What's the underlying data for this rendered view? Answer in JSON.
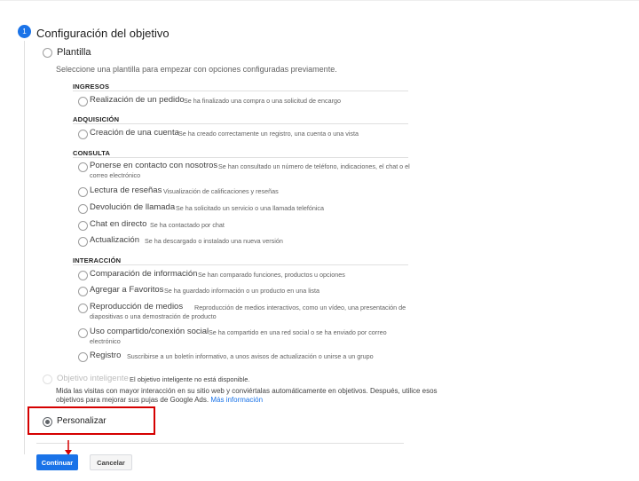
{
  "step": {
    "number": "1",
    "title": "Configuración del objetivo"
  },
  "template": {
    "label": "Plantilla",
    "description": "Seleccione una plantilla para empezar con opciones configuradas previamente.",
    "categories": [
      {
        "name": "INGRESOS",
        "options": [
          {
            "name": "Realización de un pedido",
            "desc": "Se ha finalizado una compra o una solicitud de encargo"
          }
        ]
      },
      {
        "name": "ADQUISICIÓN",
        "options": [
          {
            "name": "Creación de una cuenta",
            "desc": "Se ha creado correctamente un registro, una cuenta o una vista"
          }
        ]
      },
      {
        "name": "CONSULTA",
        "options": [
          {
            "name": "Ponerse en contacto con nosotros",
            "desc": "Se han consultado un número de teléfono, indicaciones, el chat o el correo electrónico"
          },
          {
            "name": "Lectura de reseñas",
            "desc": "Visualización de calificaciones y reseñas"
          },
          {
            "name": "Devolución de llamada",
            "desc": "Se ha solicitado un servicio o una llamada telefónica"
          },
          {
            "name": "Chat en directo",
            "desc": "Se ha contactado por chat"
          },
          {
            "name": "Actualización",
            "desc": "Se ha descargado o instalado una nueva versión"
          }
        ]
      },
      {
        "name": "INTERACCIÓN",
        "options": [
          {
            "name": "Comparación de información",
            "desc": "Se han comparado funciones, productos u opciones"
          },
          {
            "name": "Agregar a Favoritos",
            "desc": "Se ha guardado información o un producto en una lista"
          },
          {
            "name": "Reproducción de medios",
            "desc": "Reproducción de medios interactivos, como un vídeo, una presentación de diapositivas o una demostración de producto"
          },
          {
            "name": "Uso compartido/conexión social",
            "desc": "Se ha compartido en una red social o se ha enviado por correo electrónico"
          },
          {
            "name": "Registro",
            "desc": "Suscribirse a un boletín informativo, a unos avisos de actualización o unirse a un grupo"
          }
        ]
      }
    ]
  },
  "smart_goal": {
    "label": "Objetivo inteligente",
    "unavailable": "El objetivo inteligente no está disponible.",
    "description_line1": "Mida las visitas con mayor interacción en su sitio web y conviértalas automáticamente en objetivos. Después, utilice esos",
    "description_line2": "objetivos para mejorar sus pujas de Google Ads.",
    "more_info": "Más información"
  },
  "custom": {
    "label": "Personalizar",
    "selected": true
  },
  "buttons": {
    "continue": "Continuar",
    "cancel": "Cancelar"
  },
  "colors": {
    "accent": "#1a73e8",
    "highlight": "#d50000"
  }
}
